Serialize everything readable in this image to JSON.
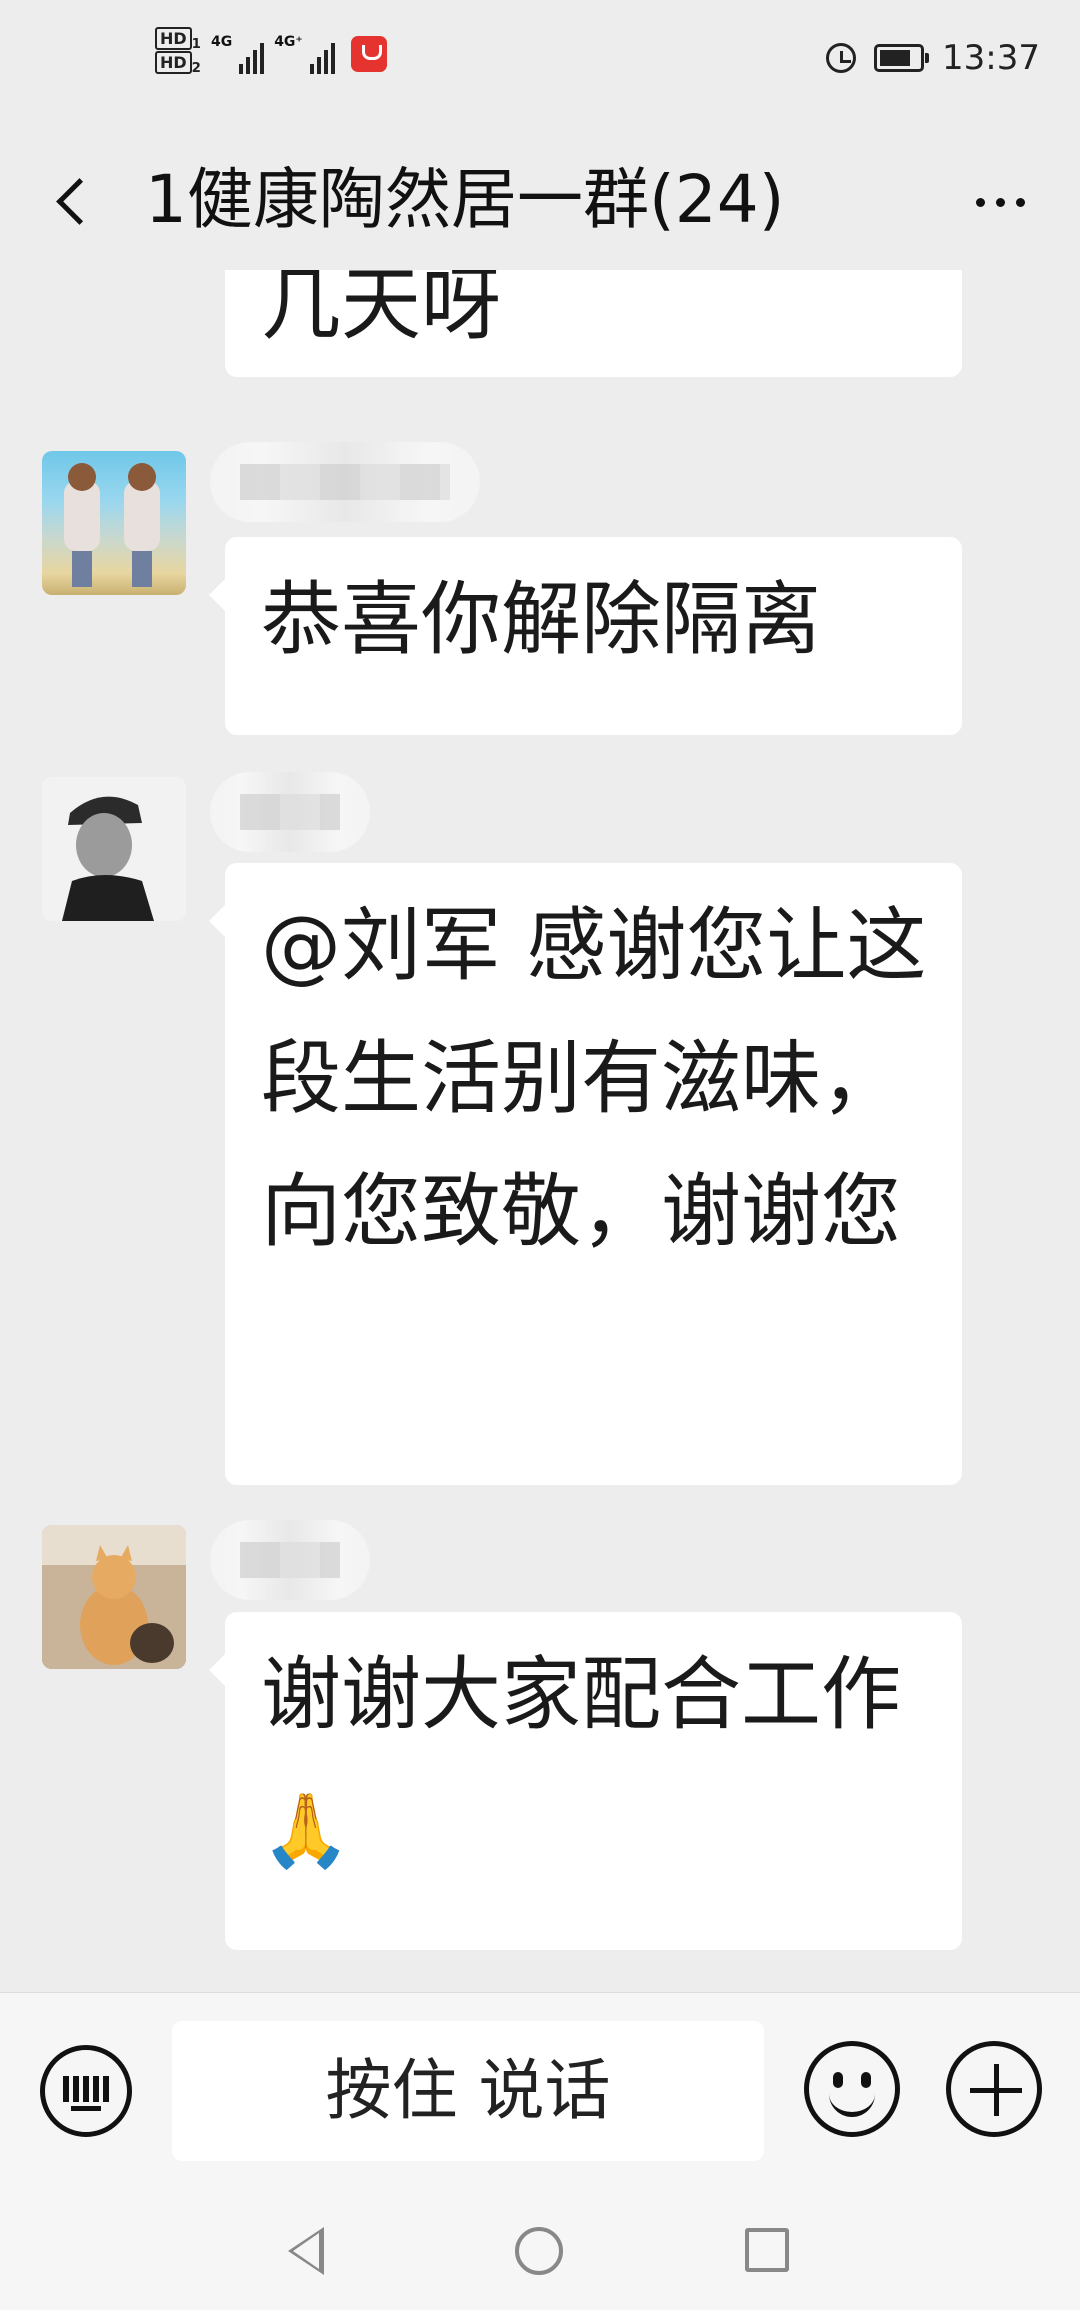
{
  "status_bar": {
    "hd1": "HD",
    "hd2": "HD",
    "sim1_index": "1",
    "sim2_index": "2",
    "network1": "4G",
    "network2": "4G⁺",
    "time": "13:37"
  },
  "header": {
    "title": "1健康陶然居一群(24)",
    "back_icon": "chevron-left-icon",
    "more_icon": "more-dots-icon"
  },
  "messages": [
    {
      "sender": "",
      "avatar": "",
      "text": "几天呀",
      "partial": true
    },
    {
      "sender": "",
      "avatar": "two-children-photo",
      "text": "恭喜你解除隔离"
    },
    {
      "sender": "",
      "avatar": "portrait-in-cap-photo",
      "text": "@刘军  感谢您让这段生活别有滋味，向您致敬，谢谢您"
    },
    {
      "sender": "",
      "avatar": "cat-photo",
      "text": "谢谢大家配合工作",
      "emoji": "🙏"
    }
  ],
  "input_bar": {
    "voice_label": "按住 说话",
    "keyboard_icon": "keyboard-icon",
    "emoji_icon": "smiley-icon",
    "plus_icon": "plus-icon"
  },
  "nav_bar": {
    "back_icon": "triangle-back-icon",
    "home_icon": "circle-home-icon",
    "recent_icon": "square-recents-icon"
  },
  "colors": {
    "background": "#ededed",
    "bubble": "#ffffff",
    "input_bar": "#f6f6f6"
  }
}
